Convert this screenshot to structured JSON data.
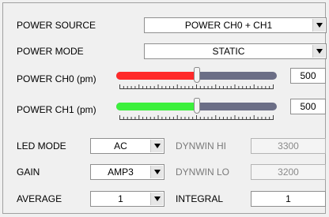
{
  "power_source": {
    "label": "POWER SOURCE",
    "value": "POWER CH0 + CH1"
  },
  "power_mode": {
    "label": "POWER MODE",
    "value": "STATIC"
  },
  "power_ch0": {
    "label": "POWER CH0 (pm)",
    "value": "500",
    "fill_fraction": 0.5,
    "fill_color": "#ff2a2a"
  },
  "power_ch1": {
    "label": "POWER CH1 (pm)",
    "value": "500",
    "fill_fraction": 0.5,
    "fill_color": "#3cf03c"
  },
  "led_mode": {
    "label": "LED MODE",
    "value": "AC"
  },
  "gain": {
    "label": "GAIN",
    "value": "AMP3"
  },
  "average": {
    "label": "AVERAGE",
    "value": "1"
  },
  "dynwin_hi": {
    "label": "DYNWIN HI",
    "value": "3300"
  },
  "dynwin_lo": {
    "label": "DYNWIN LO",
    "value": "3200"
  },
  "integral": {
    "label": "INTEGRAL",
    "value": "1"
  }
}
